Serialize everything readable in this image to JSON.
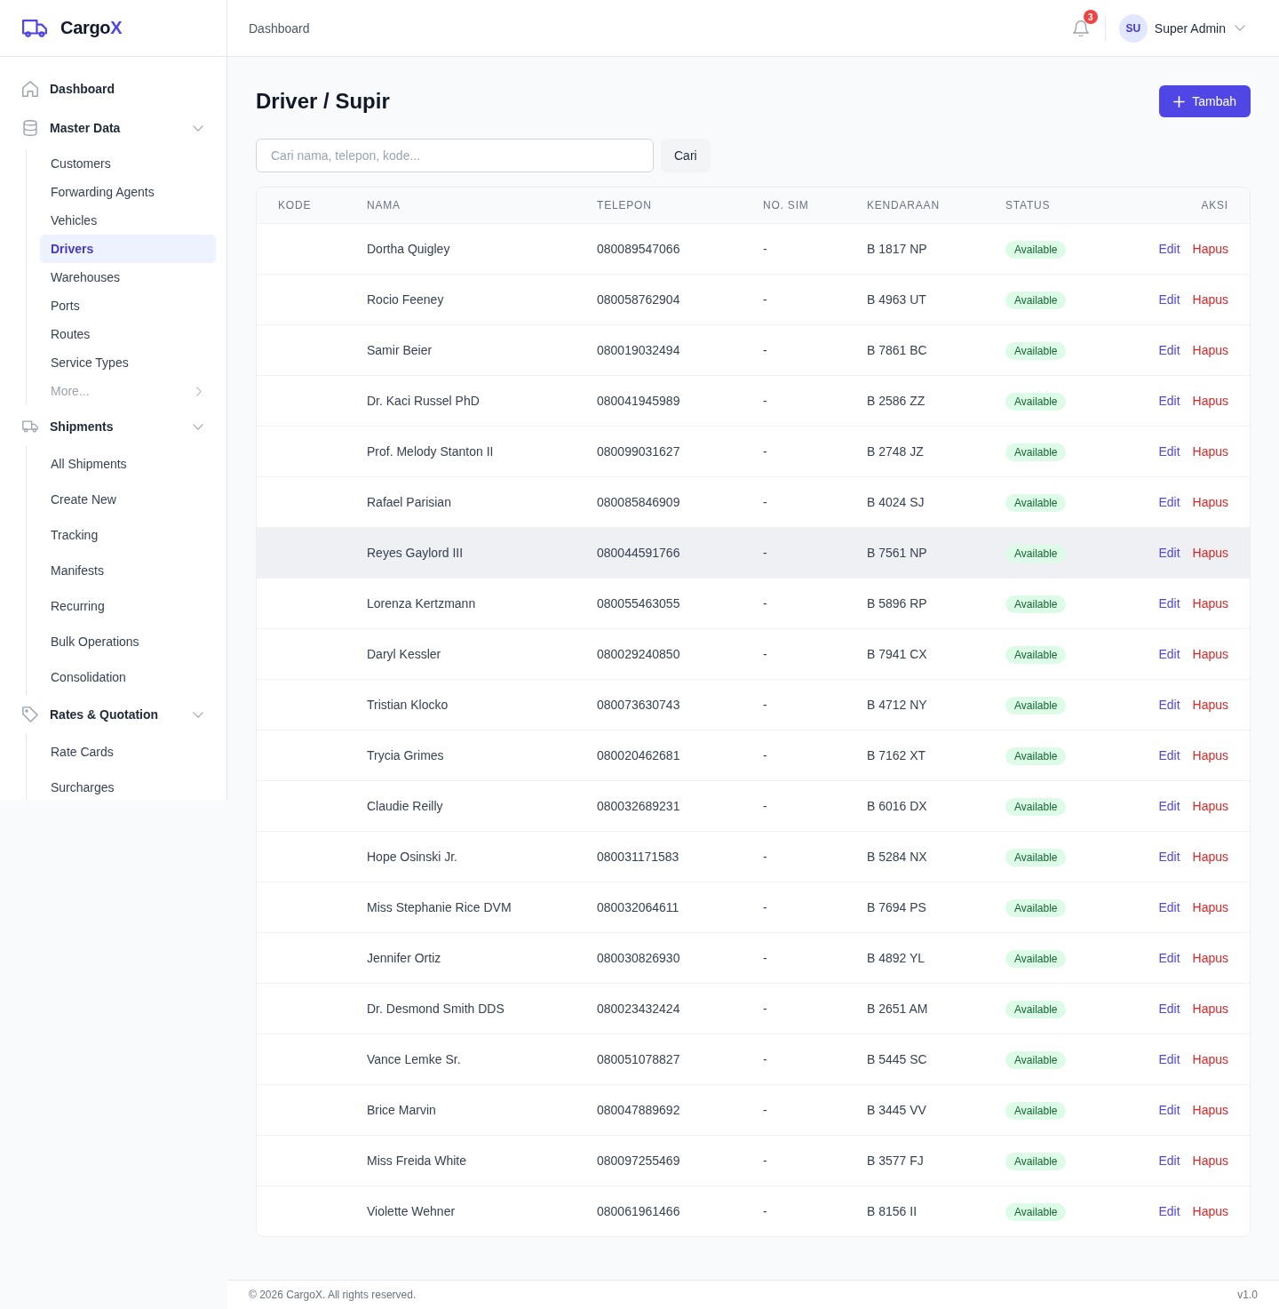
{
  "sidebar": {
    "brand": {
      "name": "Cargo",
      "accent": "X"
    },
    "nav": [
      {
        "kind": "link",
        "label": "Dashboard",
        "selected": false
      },
      {
        "kind": "group",
        "label": "Master Data",
        "expanded": true,
        "children": [
          {
            "kind": "link",
            "label": "Customers",
            "selected": false
          },
          {
            "kind": "link",
            "label": "Forwarding Agents",
            "selected": false
          },
          {
            "kind": "link",
            "label": "Vehicles",
            "selected": false
          },
          {
            "kind": "link",
            "label": "Drivers",
            "selected": true
          },
          {
            "kind": "link",
            "label": "Warehouses",
            "selected": false
          },
          {
            "kind": "link",
            "label": "Ports",
            "selected": false
          },
          {
            "kind": "link",
            "label": "Routes",
            "selected": false
          },
          {
            "kind": "link",
            "label": "Service Types",
            "selected": false
          },
          {
            "kind": "more",
            "label": "More...",
            "selected": false
          }
        ]
      },
      {
        "kind": "group",
        "label": "Shipments",
        "expanded": true,
        "children": [
          {
            "kind": "link",
            "label": "All Shipments",
            "selected": false
          },
          {
            "kind": "link",
            "label": "Create New",
            "selected": false
          },
          {
            "kind": "link",
            "label": "Tracking",
            "selected": false
          },
          {
            "kind": "link",
            "label": "Manifests",
            "selected": false
          },
          {
            "kind": "link",
            "label": "Recurring",
            "selected": false
          },
          {
            "kind": "link",
            "label": "Bulk Operations",
            "selected": false
          },
          {
            "kind": "link",
            "label": "Consolidation",
            "selected": false
          }
        ]
      },
      {
        "kind": "group",
        "label": "Rates & Quotation",
        "expanded": true,
        "children": [
          {
            "kind": "link",
            "label": "Rate Cards",
            "selected": false
          },
          {
            "kind": "link",
            "label": "Surcharges",
            "selected": false
          }
        ]
      }
    ]
  },
  "header": {
    "breadcrumb": "Dashboard",
    "notifications": {
      "count": "3"
    },
    "user": {
      "initials": "SU",
      "name": "Super Admin"
    }
  },
  "page": {
    "title": "Driver / Supir",
    "add_button": "Tambah",
    "search": {
      "placeholder": "Cari nama, telepon, kode...",
      "button": "Cari"
    }
  },
  "table": {
    "columns": [
      "KODE",
      "NAMA",
      "TELEPON",
      "NO. SIM",
      "KENDARAAN",
      "STATUS",
      "AKSI"
    ],
    "rows": [
      {
        "name": "Dortha Quigley",
        "phone": "080089547066",
        "sim": "-",
        "vehicle": "B 1817 NP",
        "status": "Available",
        "highlighted": false,
        "actions": {
          "edit": "Edit",
          "delete": "Hapus"
        }
      },
      {
        "name": "Rocio Feeney",
        "phone": "080058762904",
        "sim": "-",
        "vehicle": "B 4963 UT",
        "status": "Available",
        "highlighted": false,
        "actions": {
          "edit": "Edit",
          "delete": "Hapus"
        }
      },
      {
        "name": "Samir Beier",
        "phone": "080019032494",
        "sim": "-",
        "vehicle": "B 7861 BC",
        "status": "Available",
        "highlighted": false,
        "actions": {
          "edit": "Edit",
          "delete": "Hapus"
        }
      },
      {
        "name": "Dr. Kaci Russel PhD",
        "phone": "080041945989",
        "sim": "-",
        "vehicle": "B 2586 ZZ",
        "status": "Available",
        "highlighted": false,
        "actions": {
          "edit": "Edit",
          "delete": "Hapus"
        }
      },
      {
        "name": "Prof. Melody Stanton II",
        "phone": "080099031627",
        "sim": "-",
        "vehicle": "B 2748 JZ",
        "status": "Available",
        "highlighted": false,
        "actions": {
          "edit": "Edit",
          "delete": "Hapus"
        }
      },
      {
        "name": "Rafael Parisian",
        "phone": "080085846909",
        "sim": "-",
        "vehicle": "B 4024 SJ",
        "status": "Available",
        "highlighted": false,
        "actions": {
          "edit": "Edit",
          "delete": "Hapus"
        }
      },
      {
        "name": "Reyes Gaylord III",
        "phone": "080044591766",
        "sim": "-",
        "vehicle": "B 7561 NP",
        "status": "Available",
        "highlighted": true,
        "actions": {
          "edit": "Edit",
          "delete": "Hapus"
        }
      },
      {
        "name": "Lorenza Kertzmann",
        "phone": "080055463055",
        "sim": "-",
        "vehicle": "B 5896 RP",
        "status": "Available",
        "highlighted": false,
        "actions": {
          "edit": "Edit",
          "delete": "Hapus"
        }
      },
      {
        "name": "Daryl Kessler",
        "phone": "080029240850",
        "sim": "-",
        "vehicle": "B 7941 CX",
        "status": "Available",
        "highlighted": false,
        "actions": {
          "edit": "Edit",
          "delete": "Hapus"
        }
      },
      {
        "name": "Tristian Klocko",
        "phone": "080073630743",
        "sim": "-",
        "vehicle": "B 4712 NY",
        "status": "Available",
        "highlighted": false,
        "actions": {
          "edit": "Edit",
          "delete": "Hapus"
        }
      },
      {
        "name": "Trycia Grimes",
        "phone": "080020462681",
        "sim": "-",
        "vehicle": "B 7162 XT",
        "status": "Available",
        "highlighted": false,
        "actions": {
          "edit": "Edit",
          "delete": "Hapus"
        }
      },
      {
        "name": "Claudie Reilly",
        "phone": "080032689231",
        "sim": "-",
        "vehicle": "B 6016 DX",
        "status": "Available",
        "highlighted": false,
        "actions": {
          "edit": "Edit",
          "delete": "Hapus"
        }
      },
      {
        "name": "Hope Osinski Jr.",
        "phone": "080031171583",
        "sim": "-",
        "vehicle": "B 5284 NX",
        "status": "Available",
        "highlighted": false,
        "actions": {
          "edit": "Edit",
          "delete": "Hapus"
        }
      },
      {
        "name": "Miss Stephanie Rice DVM",
        "phone": "080032064611",
        "sim": "-",
        "vehicle": "B 7694 PS",
        "status": "Available",
        "highlighted": false,
        "actions": {
          "edit": "Edit",
          "delete": "Hapus"
        }
      },
      {
        "name": "Jennifer Ortiz",
        "phone": "080030826930",
        "sim": "-",
        "vehicle": "B 4892 YL",
        "status": "Available",
        "highlighted": false,
        "actions": {
          "edit": "Edit",
          "delete": "Hapus"
        }
      },
      {
        "name": "Dr. Desmond Smith DDS",
        "phone": "080023432424",
        "sim": "-",
        "vehicle": "B 2651 AM",
        "status": "Available",
        "highlighted": false,
        "actions": {
          "edit": "Edit",
          "delete": "Hapus"
        }
      },
      {
        "name": "Vance Lemke Sr.",
        "phone": "080051078827",
        "sim": "-",
        "vehicle": "B 5445 SC",
        "status": "Available",
        "highlighted": false,
        "actions": {
          "edit": "Edit",
          "delete": "Hapus"
        }
      },
      {
        "name": "Brice Marvin",
        "phone": "080047889692",
        "sim": "-",
        "vehicle": "B 3445 VV",
        "status": "Available",
        "highlighted": false,
        "actions": {
          "edit": "Edit",
          "delete": "Hapus"
        }
      },
      {
        "name": "Miss Freida White",
        "phone": "080097255469",
        "sim": "-",
        "vehicle": "B 3577 FJ",
        "status": "Available",
        "highlighted": false,
        "actions": {
          "edit": "Edit",
          "delete": "Hapus"
        }
      },
      {
        "name": "Violette Wehner",
        "phone": "080061961466",
        "sim": "-",
        "vehicle": "B 8156 II",
        "status": "Available",
        "highlighted": false,
        "actions": {
          "edit": "Edit",
          "delete": "Hapus"
        }
      }
    ]
  },
  "footer": {
    "copyright": "© 2026 CargoX. All rights reserved.",
    "version": "v1.0"
  }
}
